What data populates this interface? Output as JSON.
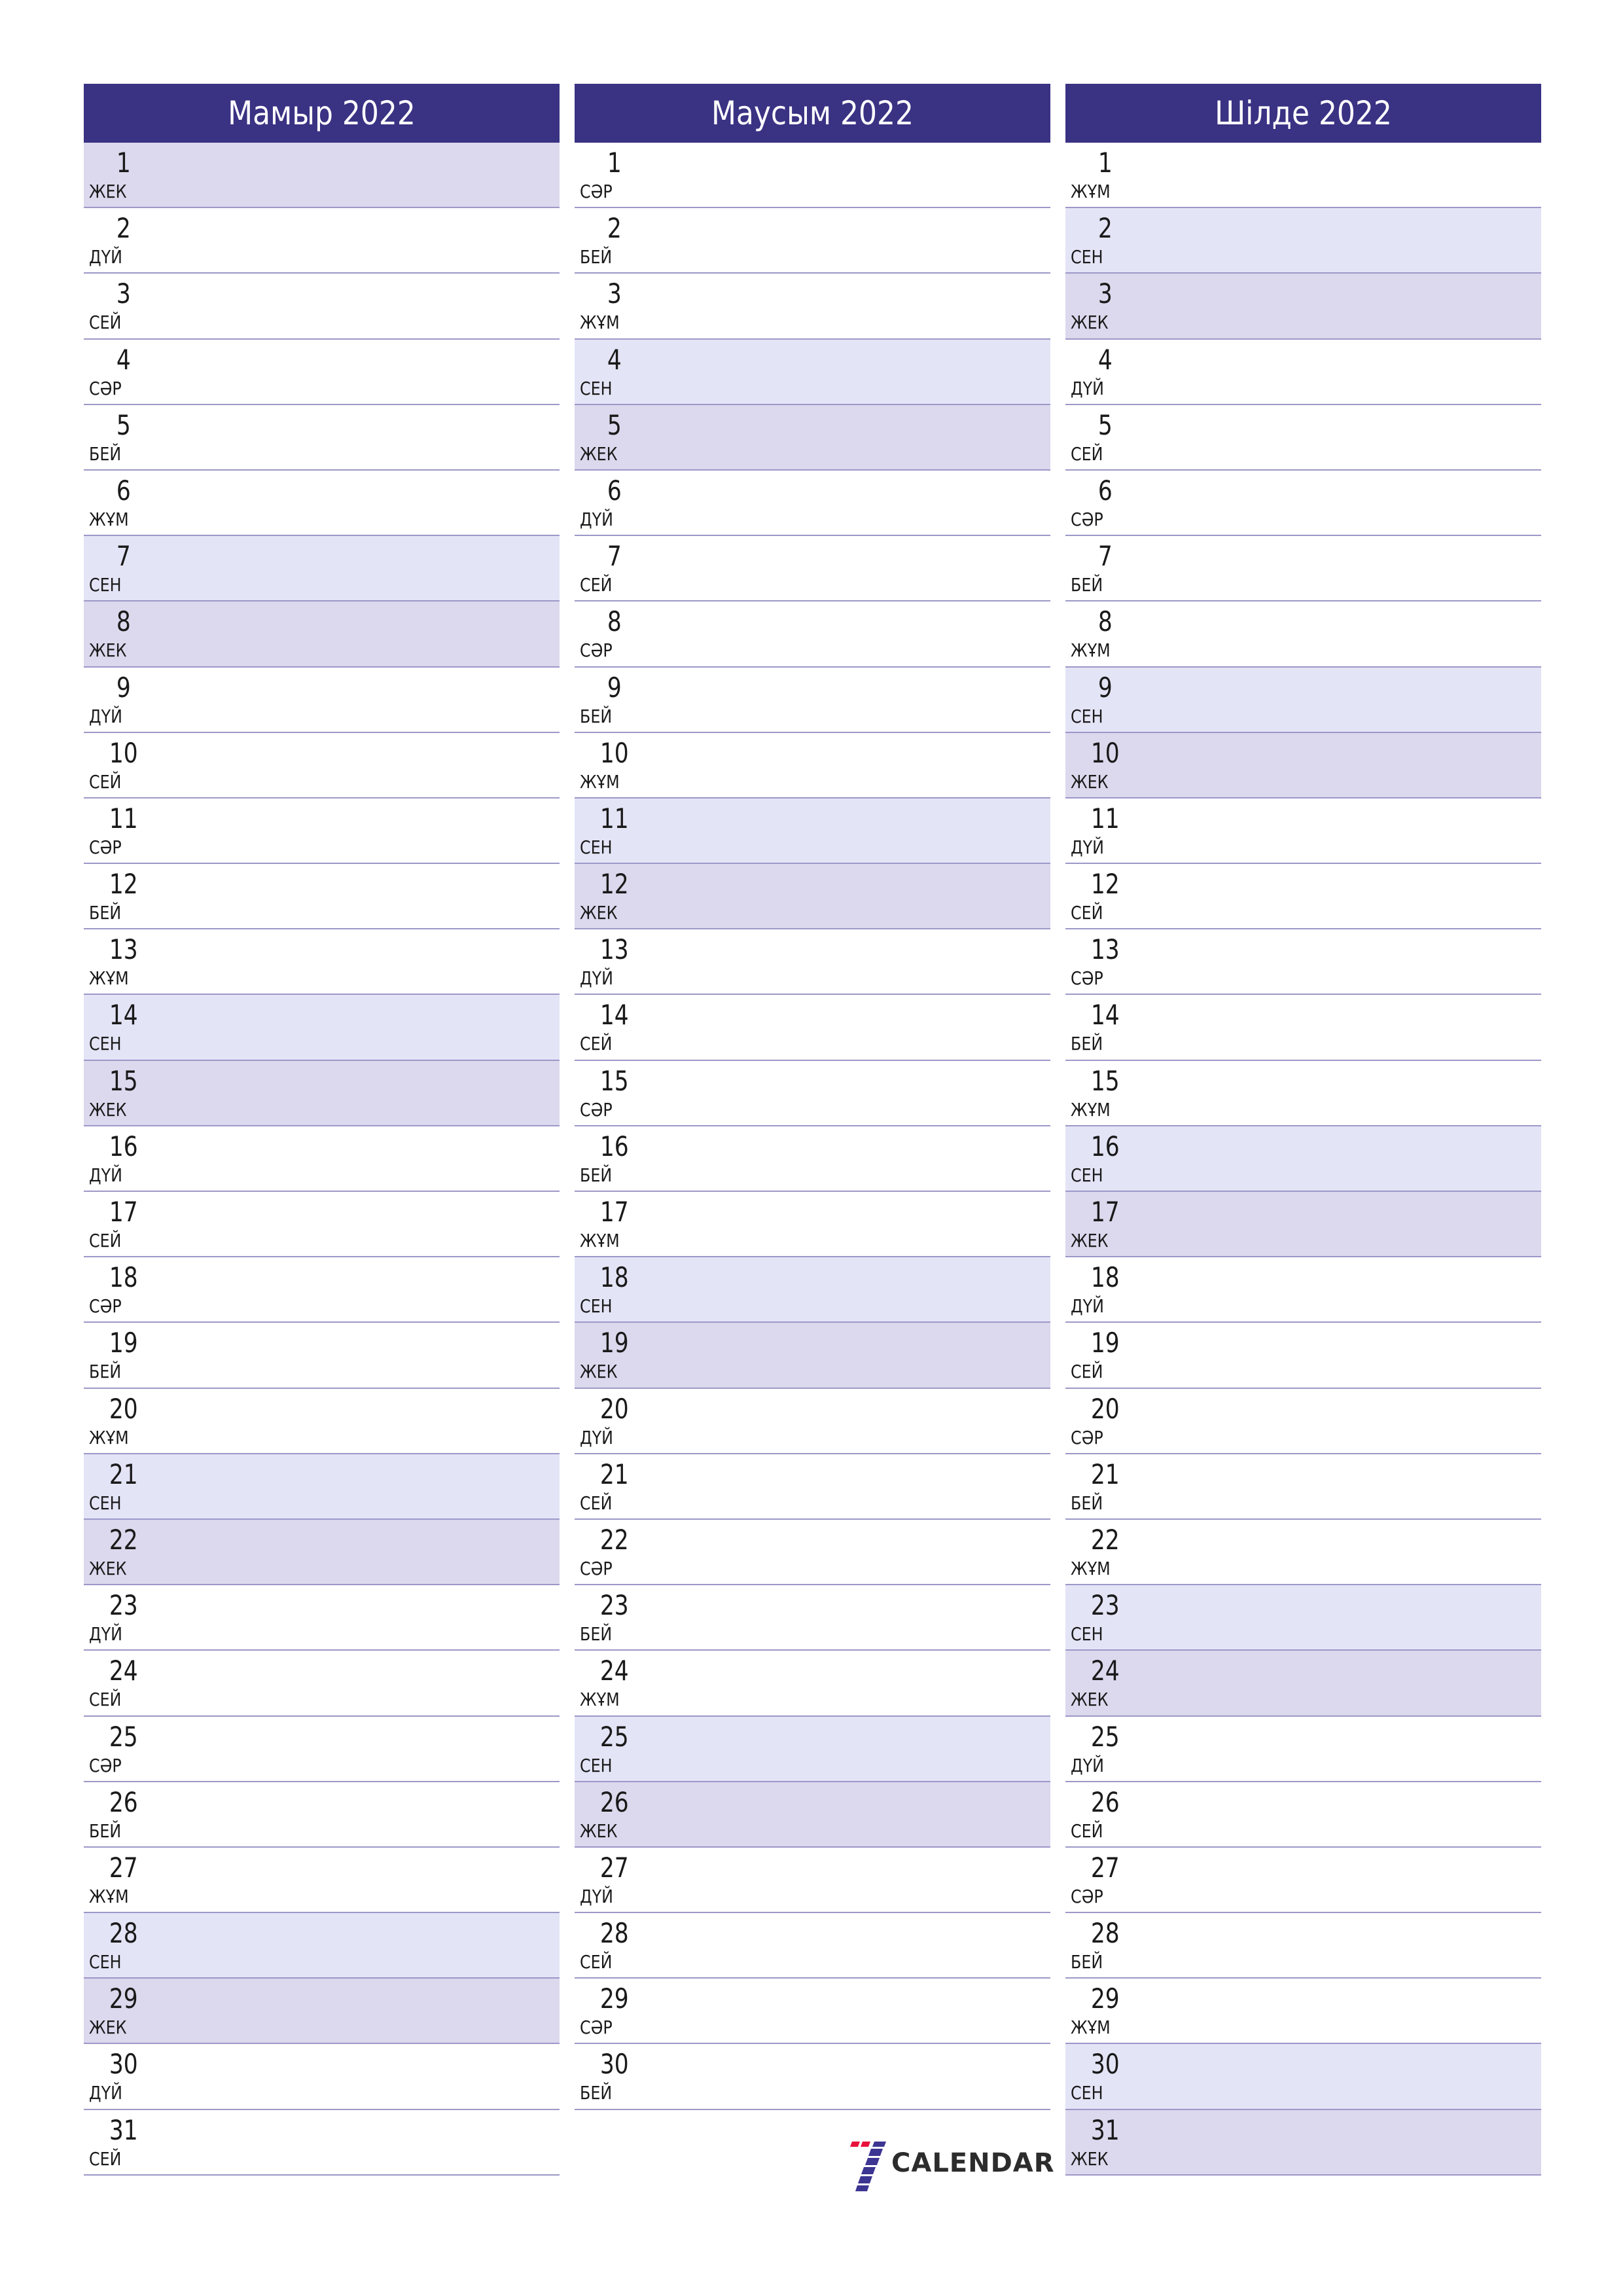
{
  "months": [
    {
      "title": "Мамыр 2022",
      "days": [
        {
          "num": "1",
          "wd": "ЖЕК",
          "type": "sun"
        },
        {
          "num": "2",
          "wd": "ДҮЙ",
          "type": ""
        },
        {
          "num": "3",
          "wd": "СЕЙ",
          "type": ""
        },
        {
          "num": "4",
          "wd": "СӘР",
          "type": ""
        },
        {
          "num": "5",
          "wd": "БЕЙ",
          "type": ""
        },
        {
          "num": "6",
          "wd": "ЖҰМ",
          "type": ""
        },
        {
          "num": "7",
          "wd": "СЕН",
          "type": "sat"
        },
        {
          "num": "8",
          "wd": "ЖЕК",
          "type": "sun"
        },
        {
          "num": "9",
          "wd": "ДҮЙ",
          "type": ""
        },
        {
          "num": "10",
          "wd": "СЕЙ",
          "type": ""
        },
        {
          "num": "11",
          "wd": "СӘР",
          "type": ""
        },
        {
          "num": "12",
          "wd": "БЕЙ",
          "type": ""
        },
        {
          "num": "13",
          "wd": "ЖҰМ",
          "type": ""
        },
        {
          "num": "14",
          "wd": "СЕН",
          "type": "sat"
        },
        {
          "num": "15",
          "wd": "ЖЕК",
          "type": "sun"
        },
        {
          "num": "16",
          "wd": "ДҮЙ",
          "type": ""
        },
        {
          "num": "17",
          "wd": "СЕЙ",
          "type": ""
        },
        {
          "num": "18",
          "wd": "СӘР",
          "type": ""
        },
        {
          "num": "19",
          "wd": "БЕЙ",
          "type": ""
        },
        {
          "num": "20",
          "wd": "ЖҰМ",
          "type": ""
        },
        {
          "num": "21",
          "wd": "СЕН",
          "type": "sat"
        },
        {
          "num": "22",
          "wd": "ЖЕК",
          "type": "sun"
        },
        {
          "num": "23",
          "wd": "ДҮЙ",
          "type": ""
        },
        {
          "num": "24",
          "wd": "СЕЙ",
          "type": ""
        },
        {
          "num": "25",
          "wd": "СӘР",
          "type": ""
        },
        {
          "num": "26",
          "wd": "БЕЙ",
          "type": ""
        },
        {
          "num": "27",
          "wd": "ЖҰМ",
          "type": ""
        },
        {
          "num": "28",
          "wd": "СЕН",
          "type": "sat"
        },
        {
          "num": "29",
          "wd": "ЖЕК",
          "type": "sun"
        },
        {
          "num": "30",
          "wd": "ДҮЙ",
          "type": ""
        },
        {
          "num": "31",
          "wd": "СЕЙ",
          "type": ""
        }
      ]
    },
    {
      "title": "Маусым 2022",
      "days": [
        {
          "num": "1",
          "wd": "СӘР",
          "type": ""
        },
        {
          "num": "2",
          "wd": "БЕЙ",
          "type": ""
        },
        {
          "num": "3",
          "wd": "ЖҰМ",
          "type": ""
        },
        {
          "num": "4",
          "wd": "СЕН",
          "type": "sat"
        },
        {
          "num": "5",
          "wd": "ЖЕК",
          "type": "sun"
        },
        {
          "num": "6",
          "wd": "ДҮЙ",
          "type": ""
        },
        {
          "num": "7",
          "wd": "СЕЙ",
          "type": ""
        },
        {
          "num": "8",
          "wd": "СӘР",
          "type": ""
        },
        {
          "num": "9",
          "wd": "БЕЙ",
          "type": ""
        },
        {
          "num": "10",
          "wd": "ЖҰМ",
          "type": ""
        },
        {
          "num": "11",
          "wd": "СЕН",
          "type": "sat"
        },
        {
          "num": "12",
          "wd": "ЖЕК",
          "type": "sun"
        },
        {
          "num": "13",
          "wd": "ДҮЙ",
          "type": ""
        },
        {
          "num": "14",
          "wd": "СЕЙ",
          "type": ""
        },
        {
          "num": "15",
          "wd": "СӘР",
          "type": ""
        },
        {
          "num": "16",
          "wd": "БЕЙ",
          "type": ""
        },
        {
          "num": "17",
          "wd": "ЖҰМ",
          "type": ""
        },
        {
          "num": "18",
          "wd": "СЕН",
          "type": "sat"
        },
        {
          "num": "19",
          "wd": "ЖЕК",
          "type": "sun"
        },
        {
          "num": "20",
          "wd": "ДҮЙ",
          "type": ""
        },
        {
          "num": "21",
          "wd": "СЕЙ",
          "type": ""
        },
        {
          "num": "22",
          "wd": "СӘР",
          "type": ""
        },
        {
          "num": "23",
          "wd": "БЕЙ",
          "type": ""
        },
        {
          "num": "24",
          "wd": "ЖҰМ",
          "type": ""
        },
        {
          "num": "25",
          "wd": "СЕН",
          "type": "sat"
        },
        {
          "num": "26",
          "wd": "ЖЕК",
          "type": "sun"
        },
        {
          "num": "27",
          "wd": "ДҮЙ",
          "type": ""
        },
        {
          "num": "28",
          "wd": "СЕЙ",
          "type": ""
        },
        {
          "num": "29",
          "wd": "СӘР",
          "type": ""
        },
        {
          "num": "30",
          "wd": "БЕЙ",
          "type": ""
        }
      ]
    },
    {
      "title": "Шілде 2022",
      "days": [
        {
          "num": "1",
          "wd": "ЖҰМ",
          "type": ""
        },
        {
          "num": "2",
          "wd": "СЕН",
          "type": "sat"
        },
        {
          "num": "3",
          "wd": "ЖЕК",
          "type": "sun"
        },
        {
          "num": "4",
          "wd": "ДҮЙ",
          "type": ""
        },
        {
          "num": "5",
          "wd": "СЕЙ",
          "type": ""
        },
        {
          "num": "6",
          "wd": "СӘР",
          "type": ""
        },
        {
          "num": "7",
          "wd": "БЕЙ",
          "type": ""
        },
        {
          "num": "8",
          "wd": "ЖҰМ",
          "type": ""
        },
        {
          "num": "9",
          "wd": "СЕН",
          "type": "sat"
        },
        {
          "num": "10",
          "wd": "ЖЕК",
          "type": "sun"
        },
        {
          "num": "11",
          "wd": "ДҮЙ",
          "type": ""
        },
        {
          "num": "12",
          "wd": "СЕЙ",
          "type": ""
        },
        {
          "num": "13",
          "wd": "СӘР",
          "type": ""
        },
        {
          "num": "14",
          "wd": "БЕЙ",
          "type": ""
        },
        {
          "num": "15",
          "wd": "ЖҰМ",
          "type": ""
        },
        {
          "num": "16",
          "wd": "СЕН",
          "type": "sat"
        },
        {
          "num": "17",
          "wd": "ЖЕК",
          "type": "sun"
        },
        {
          "num": "18",
          "wd": "ДҮЙ",
          "type": ""
        },
        {
          "num": "19",
          "wd": "СЕЙ",
          "type": ""
        },
        {
          "num": "20",
          "wd": "СӘР",
          "type": ""
        },
        {
          "num": "21",
          "wd": "БЕЙ",
          "type": ""
        },
        {
          "num": "22",
          "wd": "ЖҰМ",
          "type": ""
        },
        {
          "num": "23",
          "wd": "СЕН",
          "type": "sat"
        },
        {
          "num": "24",
          "wd": "ЖЕК",
          "type": "sun"
        },
        {
          "num": "25",
          "wd": "ДҮЙ",
          "type": ""
        },
        {
          "num": "26",
          "wd": "СЕЙ",
          "type": ""
        },
        {
          "num": "27",
          "wd": "СӘР",
          "type": ""
        },
        {
          "num": "28",
          "wd": "БЕЙ",
          "type": ""
        },
        {
          "num": "29",
          "wd": "ЖҰМ",
          "type": ""
        },
        {
          "num": "30",
          "wd": "СЕН",
          "type": "sat"
        },
        {
          "num": "31",
          "wd": "ЖЕК",
          "type": "sun"
        }
      ]
    }
  ],
  "logo": {
    "text": "CALENDAR",
    "icon": "seven-stripes-icon",
    "colors": {
      "red": "#e8123c",
      "blue": "#3d3592"
    }
  },
  "colors": {
    "header": "#3a3283",
    "saturday": "#e4e4f7",
    "sunday": "#dcd8ed",
    "separator": "#9c98c8"
  }
}
